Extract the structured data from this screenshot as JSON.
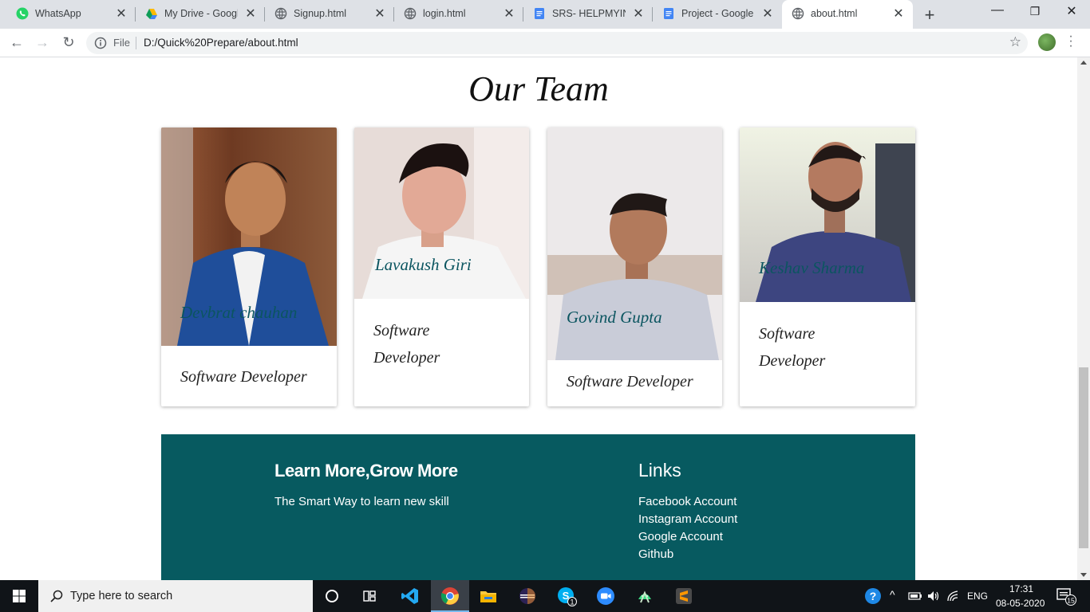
{
  "browser": {
    "tabs": [
      {
        "title": "WhatsApp",
        "icon": "whatsapp-icon"
      },
      {
        "title": "My Drive - Google",
        "icon": "google-drive-icon"
      },
      {
        "title": "Signup.html",
        "icon": "globe-icon"
      },
      {
        "title": "login.html",
        "icon": "globe-icon"
      },
      {
        "title": "SRS- HELPMYINTE",
        "icon": "google-docs-icon"
      },
      {
        "title": "Project - Google D",
        "icon": "google-docs-icon"
      },
      {
        "title": "about.html",
        "icon": "globe-icon",
        "active": true
      }
    ],
    "address": {
      "scheme_label": "File",
      "url": "D:/Quick%20Prepare/about.html"
    }
  },
  "page": {
    "heading": "Our Team",
    "members": [
      {
        "name": "Devbrat chauhan",
        "role": "Software Developer"
      },
      {
        "name": "Lavakush Giri",
        "role": "Software Developer"
      },
      {
        "name": "Govind Gupta",
        "role": "Software Developer"
      },
      {
        "name": "Keshav Sharma",
        "role": "Software Developer"
      }
    ],
    "footer": {
      "brand": "Learn More,Grow More",
      "tagline": "The Smart Way to learn new skill",
      "links_title": "Links",
      "links": [
        "Facebook Account",
        "Instagram Account",
        "Google Account",
        "Github"
      ]
    }
  },
  "taskbar": {
    "search_placeholder": "Type here to search",
    "apps": [
      "cortana-icon",
      "task-view-icon",
      "vscode-icon",
      "chrome-icon",
      "file-explorer-icon",
      "eclipse-icon",
      "skype-icon",
      "zoom-icon",
      "android-studio-icon",
      "sublime-text-icon"
    ],
    "skype_badge": "1",
    "language": "ENG",
    "time": "17:31",
    "date": "08-05-2020",
    "notifications": "15"
  },
  "colors": {
    "footer_bg": "#075a60",
    "name_text": "#0b5560"
  }
}
